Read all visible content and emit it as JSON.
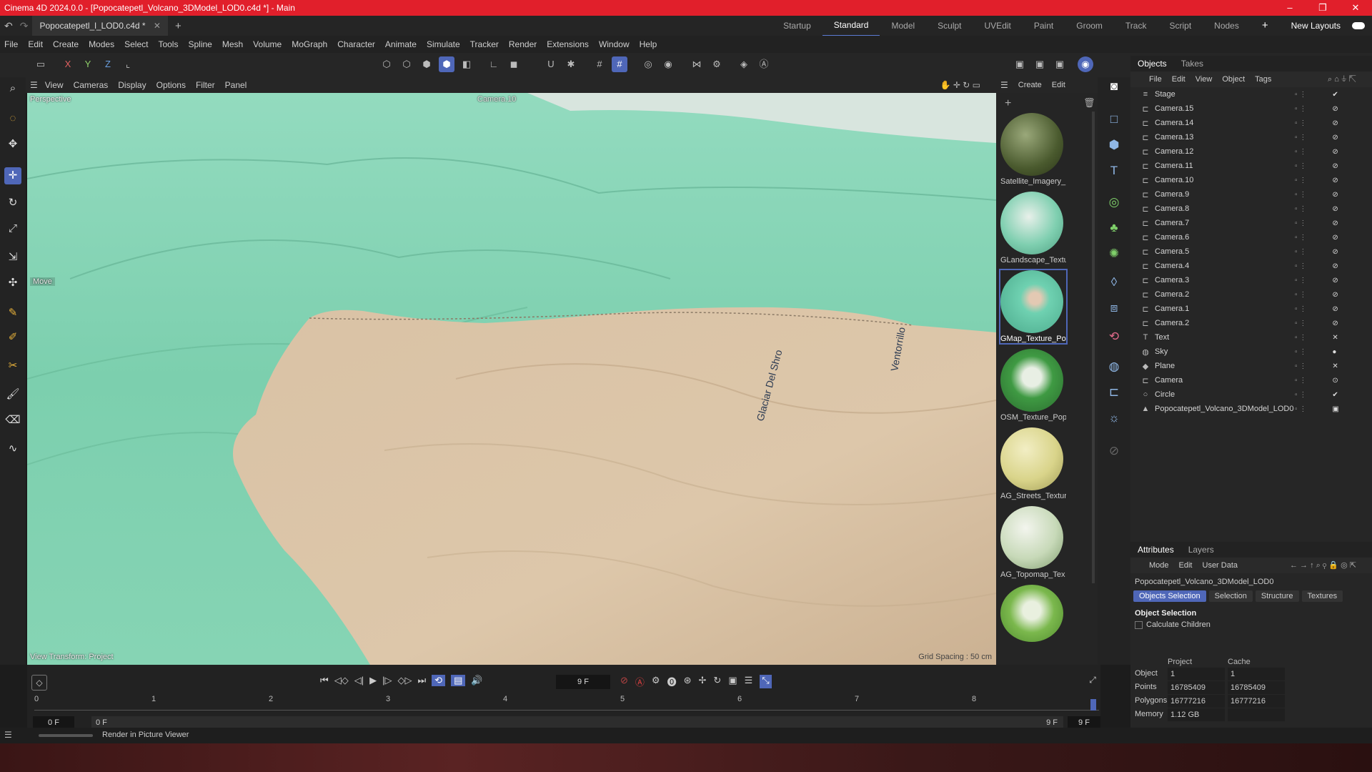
{
  "window": {
    "title": "Cinema 4D 2024.0.0 - [Popocatepetl_Volcano_3DModel_LOD0.c4d *] - Main",
    "controls": [
      "–",
      "❐",
      "✕"
    ]
  },
  "tabs": {
    "document": "Popocatepetl_l_LOD0.c4d *",
    "add": "+",
    "layouts": [
      "Startup",
      "Standard",
      "Model",
      "Sculpt",
      "UVEdit",
      "Paint",
      "Groom",
      "Track",
      "Script",
      "Nodes"
    ],
    "add_layout": "+",
    "new_layouts": "New Layouts"
  },
  "menu": [
    "File",
    "Edit",
    "Create",
    "Modes",
    "Select",
    "Tools",
    "Spline",
    "Mesh",
    "Volume",
    "MoGraph",
    "Character",
    "Animate",
    "Simulate",
    "Tracker",
    "Render",
    "Extensions",
    "Window",
    "Help"
  ],
  "toolbar": {
    "axis_x": "X",
    "axis_y": "Y",
    "axis_z": "Z"
  },
  "viewport": {
    "menu": [
      "View",
      "Cameras",
      "Display",
      "Options",
      "Filter",
      "Panel"
    ],
    "name": "Perspective",
    "camera": "Camera.10",
    "tool_hint": "Move",
    "view_transform": "View Transform: Project",
    "grid_spacing": "Grid Spacing : 50 cm",
    "terrain_labels": [
      "Glaciar Del Shro",
      "Ventorrillo"
    ]
  },
  "materials": {
    "menu": [
      "Create",
      "Edit"
    ],
    "items": [
      {
        "name": "Satellite_Imagery_",
        "color_a": "#4a5a2e",
        "color_b": "#9aa87a"
      },
      {
        "name": "GLandscape_Textu",
        "color_a": "#7fcfb0",
        "color_b": "#e8f0ea"
      },
      {
        "name": "GMap_Texture_Po",
        "color_a": "#6fd1b1",
        "color_b": "#cdebd9"
      },
      {
        "name": "OSM_Texture_Pop",
        "color_a": "#3f9a43",
        "color_b": "#e8efe4"
      },
      {
        "name": "AG_Streets_Textur",
        "color_a": "#d9d48a",
        "color_b": "#f2eec4"
      },
      {
        "name": "AG_Topomap_Tex",
        "color_a": "#c7d9b8",
        "color_b": "#f3f5ee"
      },
      {
        "name": "",
        "color_a": "#7bb84d",
        "color_b": "#e9f0df"
      }
    ]
  },
  "objects": {
    "tabs": [
      "Objects",
      "Takes"
    ],
    "menu": [
      "File",
      "Edit",
      "View",
      "Object",
      "Tags"
    ],
    "rows": [
      {
        "name": "Stage",
        "icon": "≡",
        "tag": "✔"
      },
      {
        "name": "Camera.15",
        "icon": "⊏",
        "tag": "⊘"
      },
      {
        "name": "Camera.14",
        "icon": "⊏",
        "tag": "⊘"
      },
      {
        "name": "Camera.13",
        "icon": "⊏",
        "tag": "⊘"
      },
      {
        "name": "Camera.12",
        "icon": "⊏",
        "tag": "⊘"
      },
      {
        "name": "Camera.11",
        "icon": "⊏",
        "tag": "⊘"
      },
      {
        "name": "Camera.10",
        "icon": "⊏",
        "tag": "⊘"
      },
      {
        "name": "Camera.9",
        "icon": "⊏",
        "tag": "⊘"
      },
      {
        "name": "Camera.8",
        "icon": "⊏",
        "tag": "⊘"
      },
      {
        "name": "Camera.7",
        "icon": "⊏",
        "tag": "⊘"
      },
      {
        "name": "Camera.6",
        "icon": "⊏",
        "tag": "⊘"
      },
      {
        "name": "Camera.5",
        "icon": "⊏",
        "tag": "⊘"
      },
      {
        "name": "Camera.4",
        "icon": "⊏",
        "tag": "⊘"
      },
      {
        "name": "Camera.3",
        "icon": "⊏",
        "tag": "⊘"
      },
      {
        "name": "Camera.2",
        "icon": "⊏",
        "tag": "⊘"
      },
      {
        "name": "Camera.1",
        "icon": "⊏",
        "tag": "⊘"
      },
      {
        "name": "Camera.2",
        "icon": "⊏",
        "tag": "⊘"
      },
      {
        "name": "Text",
        "icon": "T",
        "tag": "✕"
      },
      {
        "name": "Sky",
        "icon": "◍",
        "tag": "●"
      },
      {
        "name": "Plane",
        "icon": "◆",
        "tag": "✕"
      },
      {
        "name": "Camera",
        "icon": "⊏",
        "tag": "⊙"
      },
      {
        "name": "Circle",
        "icon": "○",
        "tag": "✔"
      },
      {
        "name": "Popocatepetl_Volcano_3DModel_LOD0",
        "icon": "▲",
        "tag": "▣"
      }
    ]
  },
  "attributes": {
    "tabs": [
      "Attributes",
      "Layers"
    ],
    "menu": [
      "Mode",
      "Edit",
      "User Data"
    ],
    "object_name": "Popocatepetl_Volcano_3DModel_LOD0",
    "sub_tabs": [
      "Objects Selection",
      "Selection",
      "Structure",
      "Textures"
    ],
    "section": "Object Selection",
    "checkbox": "Calculate Children",
    "col_project": "Project",
    "col_cache": "Cache",
    "rows": [
      {
        "label": "Object",
        "project": "1",
        "cache": "1"
      },
      {
        "label": "Points",
        "project": "16785409",
        "cache": "16785409"
      },
      {
        "label": "Polygons",
        "project": "16777216",
        "cache": "16777216"
      },
      {
        "label": "Memory",
        "project": "1.12 GB",
        "cache": ""
      }
    ]
  },
  "timeline": {
    "current_frame": "9 F",
    "ticks": [
      "0",
      "1",
      "2",
      "3",
      "4",
      "5",
      "6",
      "7",
      "8"
    ],
    "start": "0 F",
    "start2": "0 F",
    "end": "9 F",
    "end2": "9 F"
  },
  "status": {
    "message": "Render in Picture Viewer"
  }
}
